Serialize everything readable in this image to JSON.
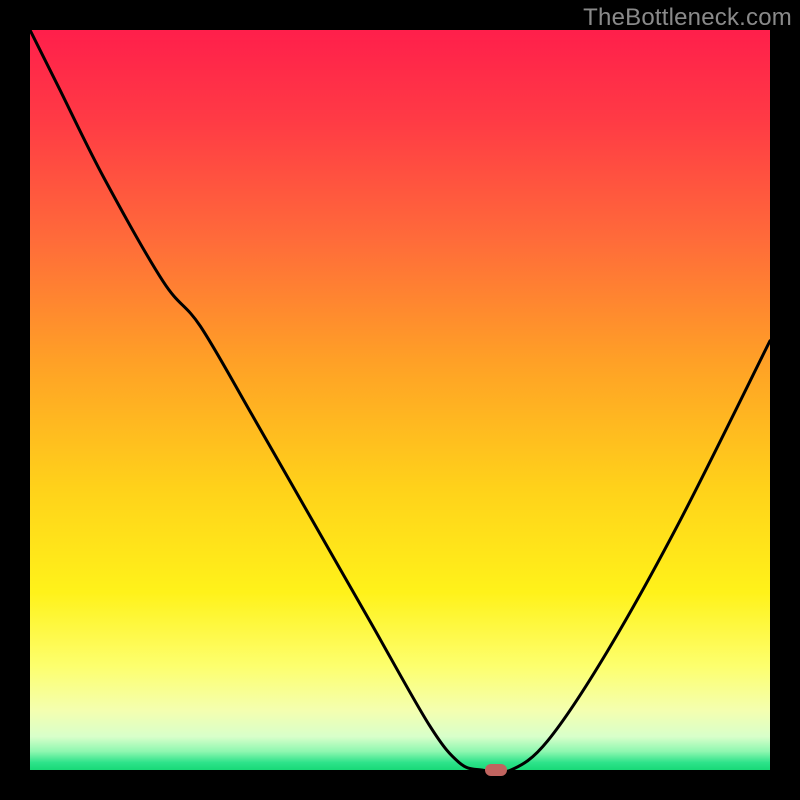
{
  "watermark": "TheBottleneck.com",
  "marker": {
    "x_pct": 63,
    "y_pct": 100
  },
  "gradient_stops": [
    {
      "pct": 0,
      "color": "#ff1f4b"
    },
    {
      "pct": 12,
      "color": "#ff3a45"
    },
    {
      "pct": 28,
      "color": "#ff6a3a"
    },
    {
      "pct": 45,
      "color": "#ffa126"
    },
    {
      "pct": 62,
      "color": "#ffd21a"
    },
    {
      "pct": 76,
      "color": "#fff21a"
    },
    {
      "pct": 86,
      "color": "#fdff6e"
    },
    {
      "pct": 92,
      "color": "#f4ffb0"
    },
    {
      "pct": 95.5,
      "color": "#d8ffca"
    },
    {
      "pct": 97.5,
      "color": "#8ef7b0"
    },
    {
      "pct": 99,
      "color": "#2de38a"
    },
    {
      "pct": 100,
      "color": "#18d977"
    }
  ],
  "chart_data": {
    "type": "line",
    "title": "",
    "xlabel": "",
    "ylabel": "",
    "x_range": [
      0,
      100
    ],
    "y_range": [
      0,
      100
    ],
    "note": "y = bottleneck percentage; 0 = ideal (bottom/green), 100 = severe (top/red). Curve read off plot; values approximate.",
    "series": [
      {
        "name": "bottleneck-curve",
        "x": [
          0,
          4,
          10,
          18,
          23,
          30,
          38,
          46,
          54,
          58,
          61,
          65,
          70,
          78,
          88,
          100
        ],
        "y": [
          100,
          92,
          80,
          66,
          60,
          48,
          34,
          20,
          6,
          1,
          0,
          0,
          4,
          16,
          34,
          58
        ]
      }
    ],
    "optimum_marker": {
      "x": 63,
      "y": 0
    }
  }
}
